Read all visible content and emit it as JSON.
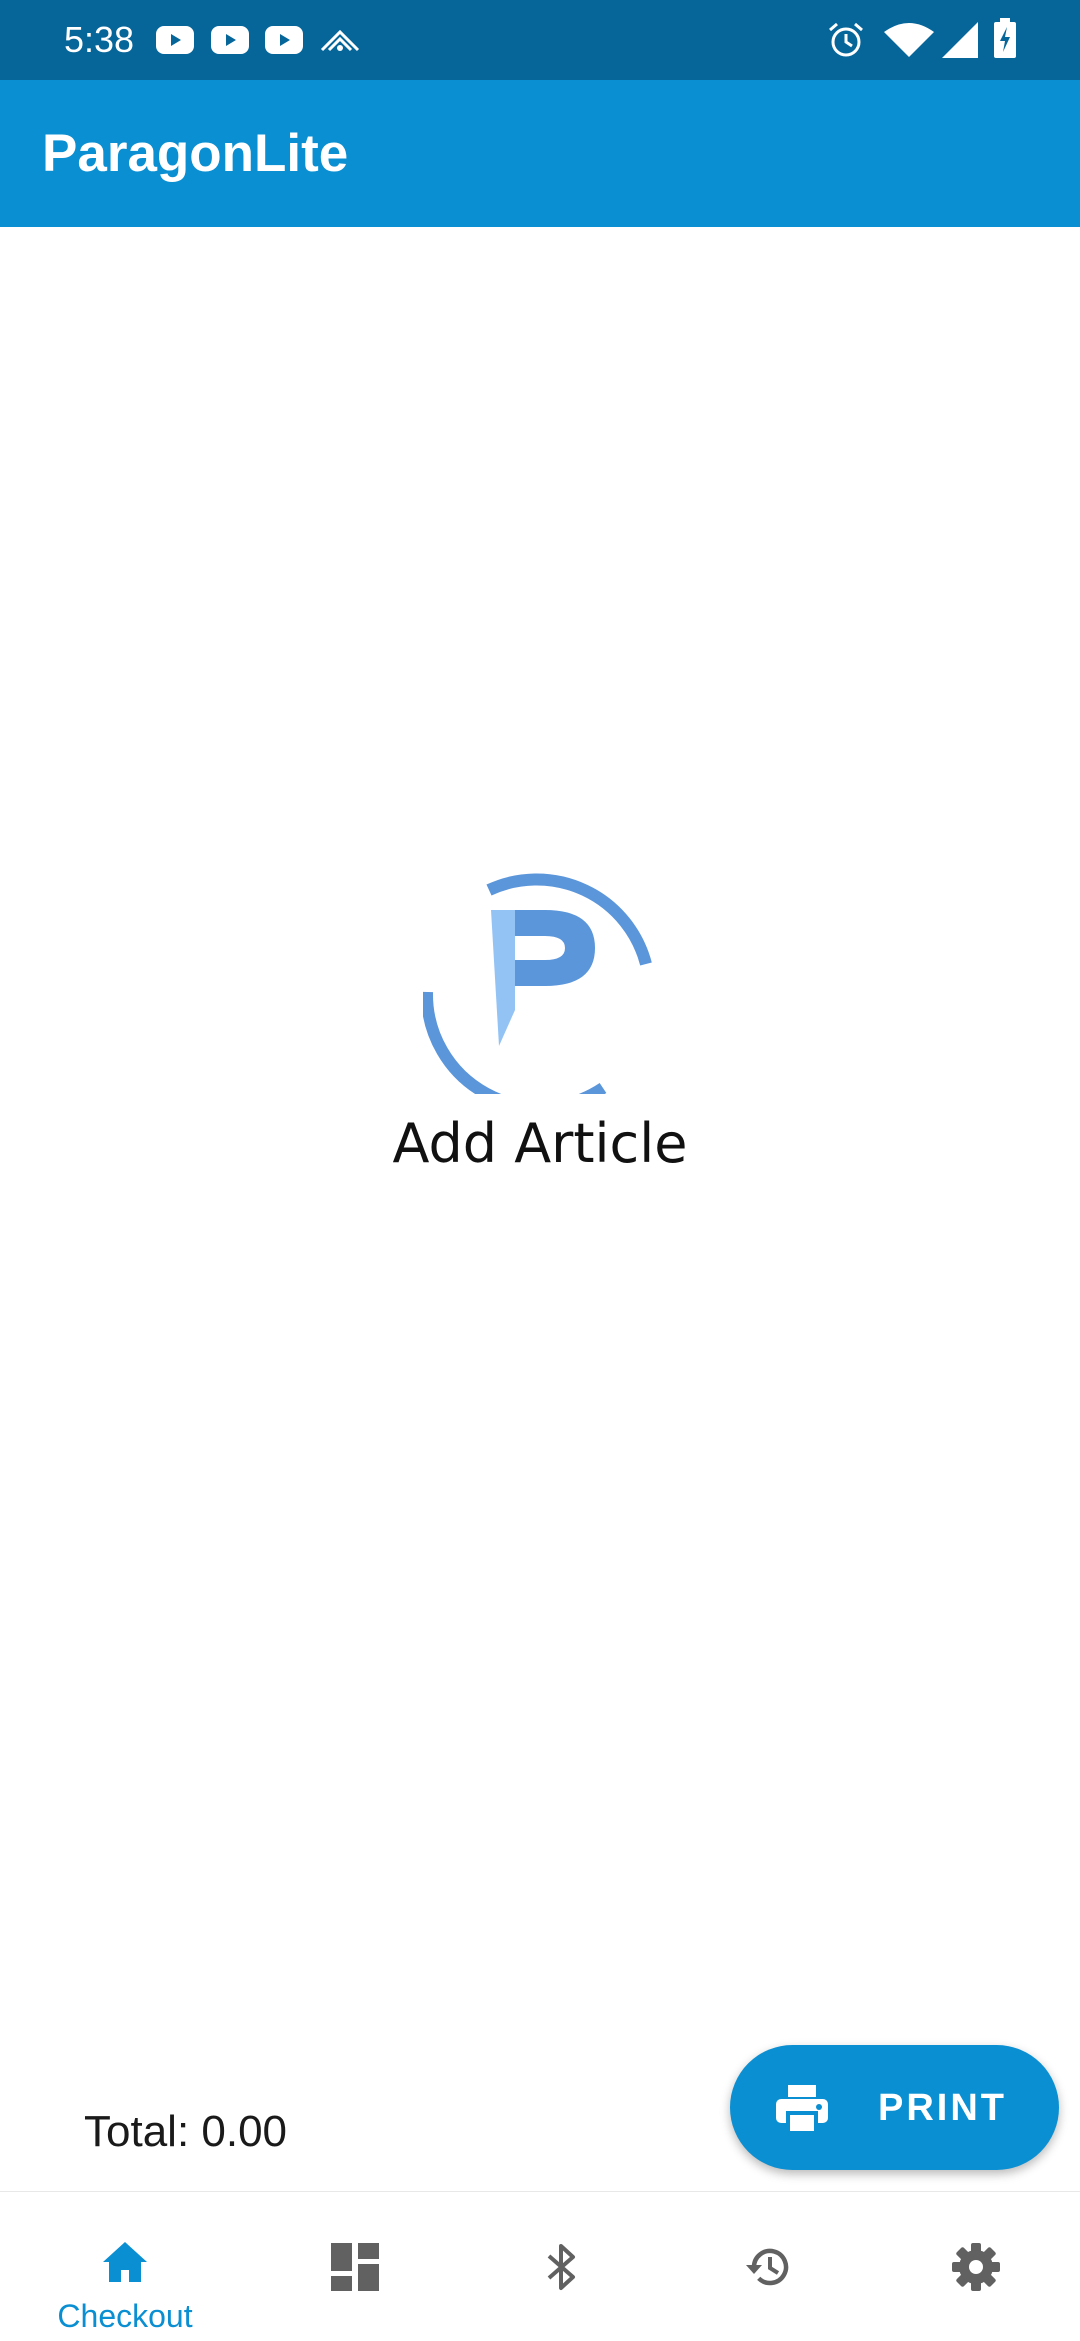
{
  "status_bar": {
    "time": "5:38",
    "left_icons": [
      "youtube-icon",
      "youtube-icon",
      "youtube-icon",
      "warframe-icon"
    ],
    "right_icons": [
      "alarm-icon",
      "wifi-icon",
      "signal-icon",
      "battery-charging-icon"
    ]
  },
  "app_bar": {
    "title": "ParagonLite"
  },
  "empty_state": {
    "icon": "paragon-logo-icon",
    "label": "Add Article"
  },
  "total": {
    "text": "Total: 0.00"
  },
  "print_button": {
    "icon": "printer-icon",
    "label": "PRINT"
  },
  "bottom_nav": {
    "items": [
      {
        "icon": "home-icon",
        "label": "Checkout",
        "selected": true
      },
      {
        "icon": "dashboard-icon",
        "label": "",
        "selected": false
      },
      {
        "icon": "bluetooth-icon",
        "label": "",
        "selected": false
      },
      {
        "icon": "history-icon",
        "label": "",
        "selected": false
      },
      {
        "icon": "settings-icon",
        "label": "",
        "selected": false
      }
    ]
  },
  "colors": {
    "status_bar": "#06669a",
    "app_bar": "#0a8fd2",
    "accent": "#0a8fd2",
    "logo_primary": "#5b96db",
    "logo_light": "#93c3f5",
    "nav_inactive": "#616161"
  }
}
